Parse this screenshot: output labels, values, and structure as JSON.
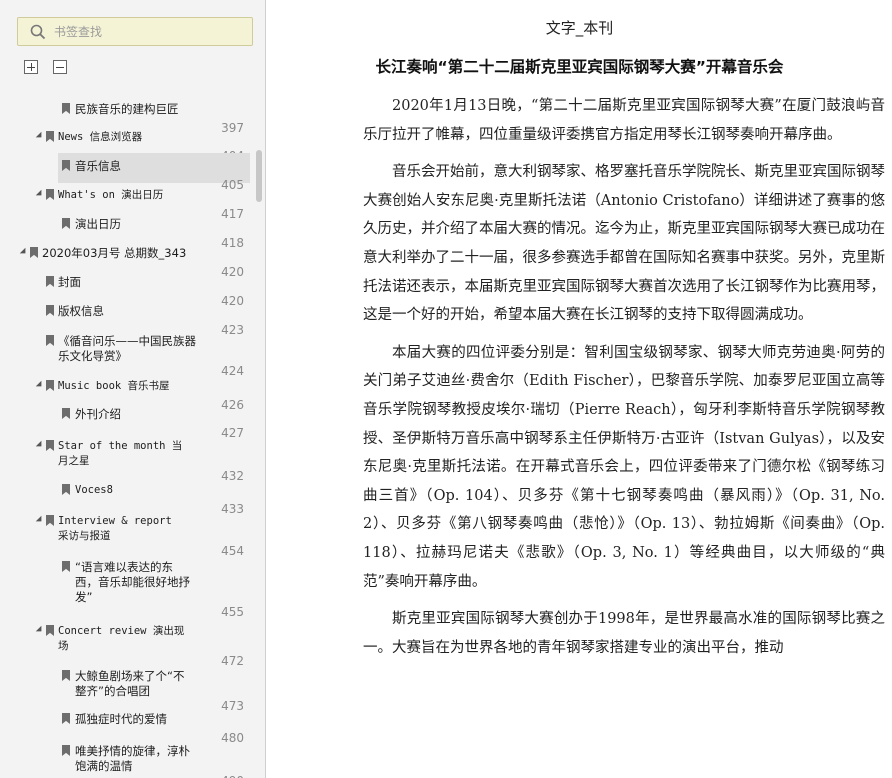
{
  "sidebar": {
    "search_placeholder": "书签查找",
    "toc": [
      {
        "label": "民族音乐的建构巨匠",
        "page": "397"
      },
      {
        "label": "News 信息浏览器",
        "page": "404"
      },
      {
        "label": "音乐信息",
        "page": "405",
        "selected": true
      },
      {
        "label": "What's on 演出日历",
        "page": "417"
      },
      {
        "label": "演出日历",
        "page": "418"
      },
      {
        "label": "2020年03月号 总期数_343",
        "page": "420"
      },
      {
        "label": "封面",
        "page": "420"
      },
      {
        "label": "版权信息",
        "page": "423"
      },
      {
        "label": "《循音问乐——中国民族器乐文化导赏》",
        "page": "424"
      },
      {
        "label": "Music book 音乐书屋",
        "page": "426"
      },
      {
        "label": "外刊介绍",
        "page": "427"
      },
      {
        "label": "Star of the month 当月之星",
        "page": "432"
      },
      {
        "label": "Voces8",
        "page": "433"
      },
      {
        "label": "Interview & report 采访与报道",
        "page": "454"
      },
      {
        "label": "“语言难以表达的东西，音乐却能很好地抒发”",
        "page": "455"
      },
      {
        "label": "Concert review 演出现场",
        "page": "472"
      },
      {
        "label": "大鲸鱼剧场来了个“不整齐”的合唱团",
        "page": "473"
      },
      {
        "label": "孤独症时代的爱情",
        "page": "480"
      },
      {
        "label": "唯美抒情的旋律，淳朴饱满的温情",
        "page": "490"
      }
    ]
  },
  "document": {
    "section_label": "文字_本刊",
    "title": "长江奏响“第二十二届斯克里亚宾国际钢琴大赛”开幕音乐会",
    "paragraphs": [
      "2020年1月13日晚，“第二十二届斯克里亚宾国际钢琴大赛”在厦门鼓浪屿音乐厅拉开了帷幕，四位重量级评委携官方指定用琴长江钢琴奏响开幕序曲。",
      "音乐会开始前，意大利钢琴家、格罗塞托音乐学院院长、斯克里亚宾国际钢琴大赛创始人安东尼奥·克里斯托法诺（Antonio Cristofano）详细讲述了赛事的悠久历史，并介绍了本届大赛的情况。迄今为止，斯克里亚宾国际钢琴大赛已成功在意大利举办了二十一届，很多参赛选手都曾在国际知名赛事中获奖。另外，克里斯托法诺还表示，本届斯克里亚宾国际钢琴大赛首次选用了长江钢琴作为比赛用琴，这是一个好的开始，希望本届大赛在长江钢琴的支持下取得圆满成功。",
      "本届大赛的四位评委分别是：智利国宝级钢琴家、钢琴大师克劳迪奥·阿劳的关门弟子艾迪丝·费舍尔（Edith Fischer），巴黎音乐学院、加泰罗尼亚国立高等音乐学院钢琴教授皮埃尔·瑞切（Pierre Reach），匈牙利李斯特音乐学院钢琴教授、圣伊斯特万音乐高中钢琴系主任伊斯特万·古亚许（Istvan Gulyas），以及安东尼奥·克里斯托法诺。在开幕式音乐会上，四位评委带来了门德尔松《钢琴练习曲三首》（Op. 104）、贝多芬《第十七钢琴奏鸣曲（暴风雨）》（Op. 31, No. 2）、贝多芬《第八钢琴奏鸣曲（悲怆）》（Op. 13）、勃拉姆斯《间奏曲》（Op. 118）、拉赫玛尼诺夫《悲歌》（Op. 3, No. 1）等经典曲目，以大师级的“典范”奏响开幕序曲。",
      "斯克里亚宾国际钢琴大赛创办于1998年，是世界最高水准的国际钢琴比赛之一。大赛旨在为世界各地的青年钢琴家搭建专业的演出平台，推动"
    ]
  }
}
